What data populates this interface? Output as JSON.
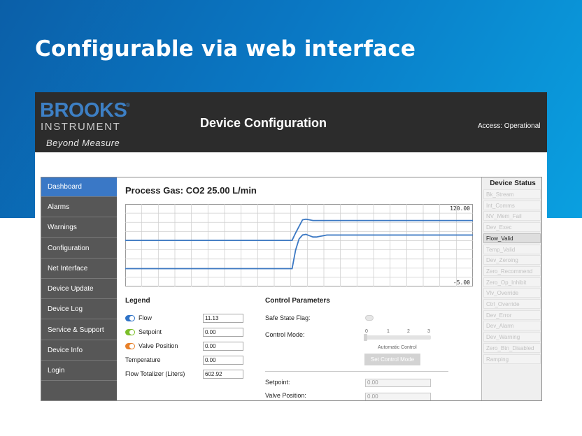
{
  "banner": {
    "title": "Configurable via web interface"
  },
  "app": {
    "brand": {
      "name": "BROOKS",
      "reg": "®",
      "sub": "INSTRUMENT",
      "tagline": "Beyond Measure"
    },
    "title": "Device Configuration",
    "access": "Access: Operational"
  },
  "sidebar": {
    "items": [
      {
        "label": "Dashboard",
        "active": true
      },
      {
        "label": "Alarms"
      },
      {
        "label": "Warnings"
      },
      {
        "label": "Configuration"
      },
      {
        "label": "Net Interface"
      },
      {
        "label": "Device Update"
      },
      {
        "label": "Device Log"
      },
      {
        "label": "Service & Support"
      },
      {
        "label": "Device Info"
      },
      {
        "label": "Login"
      }
    ]
  },
  "main": {
    "process_title": "Process Gas: CO2 25.00 L/min",
    "legend": {
      "heading": "Legend",
      "rows": [
        {
          "label": "Flow",
          "value": "11.13",
          "toggle_color": "#2f73c7"
        },
        {
          "label": "Setpoint",
          "value": "0.00",
          "toggle_color": "#7cbf2a"
        },
        {
          "label": "Valve Position",
          "value": "0.00",
          "toggle_color": "#e8812a"
        },
        {
          "label": "Temperature",
          "value": "0.00"
        },
        {
          "label": "Flow Totalizer (Liters)",
          "value": "602.92"
        }
      ]
    },
    "control": {
      "heading": "Control Parameters",
      "safe_state_label": "Safe State Flag:",
      "control_mode_label": "Control Mode:",
      "slider_ticks": [
        "0",
        "1",
        "2",
        "3"
      ],
      "slider_value": 0,
      "mode_name": "Automatic Control",
      "set_button": "Set Control Mode",
      "setpoint_label": "Setpoint:",
      "setpoint_value": "0.00",
      "valve_label": "Valve Position:",
      "valve_value": "0.00"
    }
  },
  "status": {
    "heading": "Device Status",
    "items": [
      {
        "label": "Bk_Stream"
      },
      {
        "label": "Int_Comms"
      },
      {
        "label": "NV_Mem_Fail"
      },
      {
        "label": "Dev_Exec"
      },
      {
        "label": "Flow_Valid",
        "active": true
      },
      {
        "label": "Temp_Valid"
      },
      {
        "label": "Dev_Zeroing"
      },
      {
        "label": "Zero_Recommend"
      },
      {
        "label": "Zero_Op_Inhibit"
      },
      {
        "label": "Vlv_Override"
      },
      {
        "label": "Ctrl_Override"
      },
      {
        "label": "Dev_Error"
      },
      {
        "label": "Dev_Alarm"
      },
      {
        "label": "Dev_Warning"
      },
      {
        "label": "Zero_Btn_Disabled"
      },
      {
        "label": "Ramping"
      }
    ]
  },
  "chart_data": {
    "type": "line",
    "y_max_label": "120.00",
    "y_min_label": "-5.00",
    "ylim": [
      -5,
      120
    ],
    "x": [
      0,
      10,
      20,
      30,
      40,
      48,
      49,
      50,
      51,
      52,
      53,
      54,
      55,
      56,
      57,
      58,
      59,
      60,
      70,
      80,
      90,
      100
    ],
    "grid": true,
    "series": [
      {
        "color": "#3b78c3",
        "values": [
          65,
          65,
          65,
          65,
          65,
          65,
          76,
          86,
          96,
          97,
          96,
          95,
          95,
          95,
          95,
          95,
          95,
          95,
          95,
          95,
          95,
          95
        ]
      },
      {
        "color": "#3b78c3",
        "values": [
          22,
          22,
          22,
          22,
          22,
          22,
          50,
          67,
          73,
          74,
          72,
          70,
          70,
          71,
          72,
          73,
          73,
          73,
          73,
          73,
          73,
          73
        ]
      }
    ]
  }
}
